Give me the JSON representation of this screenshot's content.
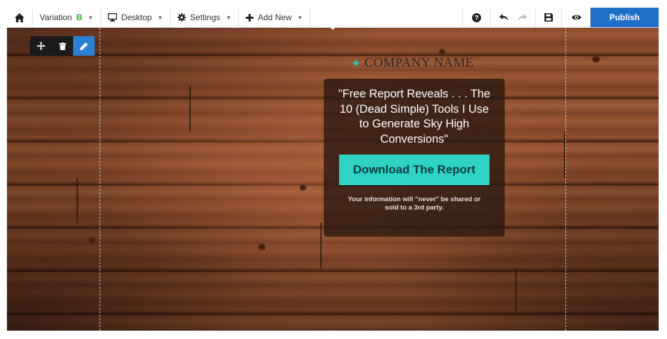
{
  "toolbar": {
    "variation_label": "Variation",
    "variation_value": "B",
    "device_label": "Desktop",
    "settings_label": "Settings",
    "add_new_label": "Add New",
    "publish_label": "Publish",
    "icons": [
      "home-icon",
      "desktop-icon",
      "gear-icon",
      "plus-icon",
      "help-icon",
      "undo-icon",
      "redo-icon",
      "save-icon",
      "preview-eye-icon"
    ]
  },
  "element_tools": {
    "icons": [
      "move-icon",
      "trash-icon",
      "pencil-icon"
    ],
    "active": "pencil-icon"
  },
  "page": {
    "logo_text": "COMPANY NAME",
    "headline": "\"Free Report Reveals . . . The 10 (Dead Simple) Tools I Use to Generate Sky High Conversions\"",
    "cta_label": "Download The Report",
    "disclaimer": "Your information will \"never\" be shared or sold to a 3rd party."
  },
  "colors": {
    "publish": "#1f6fc9",
    "cta": "#2ed3c4",
    "active_tool": "#2d7fd4",
    "logo_accent": "#2ec4b1"
  }
}
